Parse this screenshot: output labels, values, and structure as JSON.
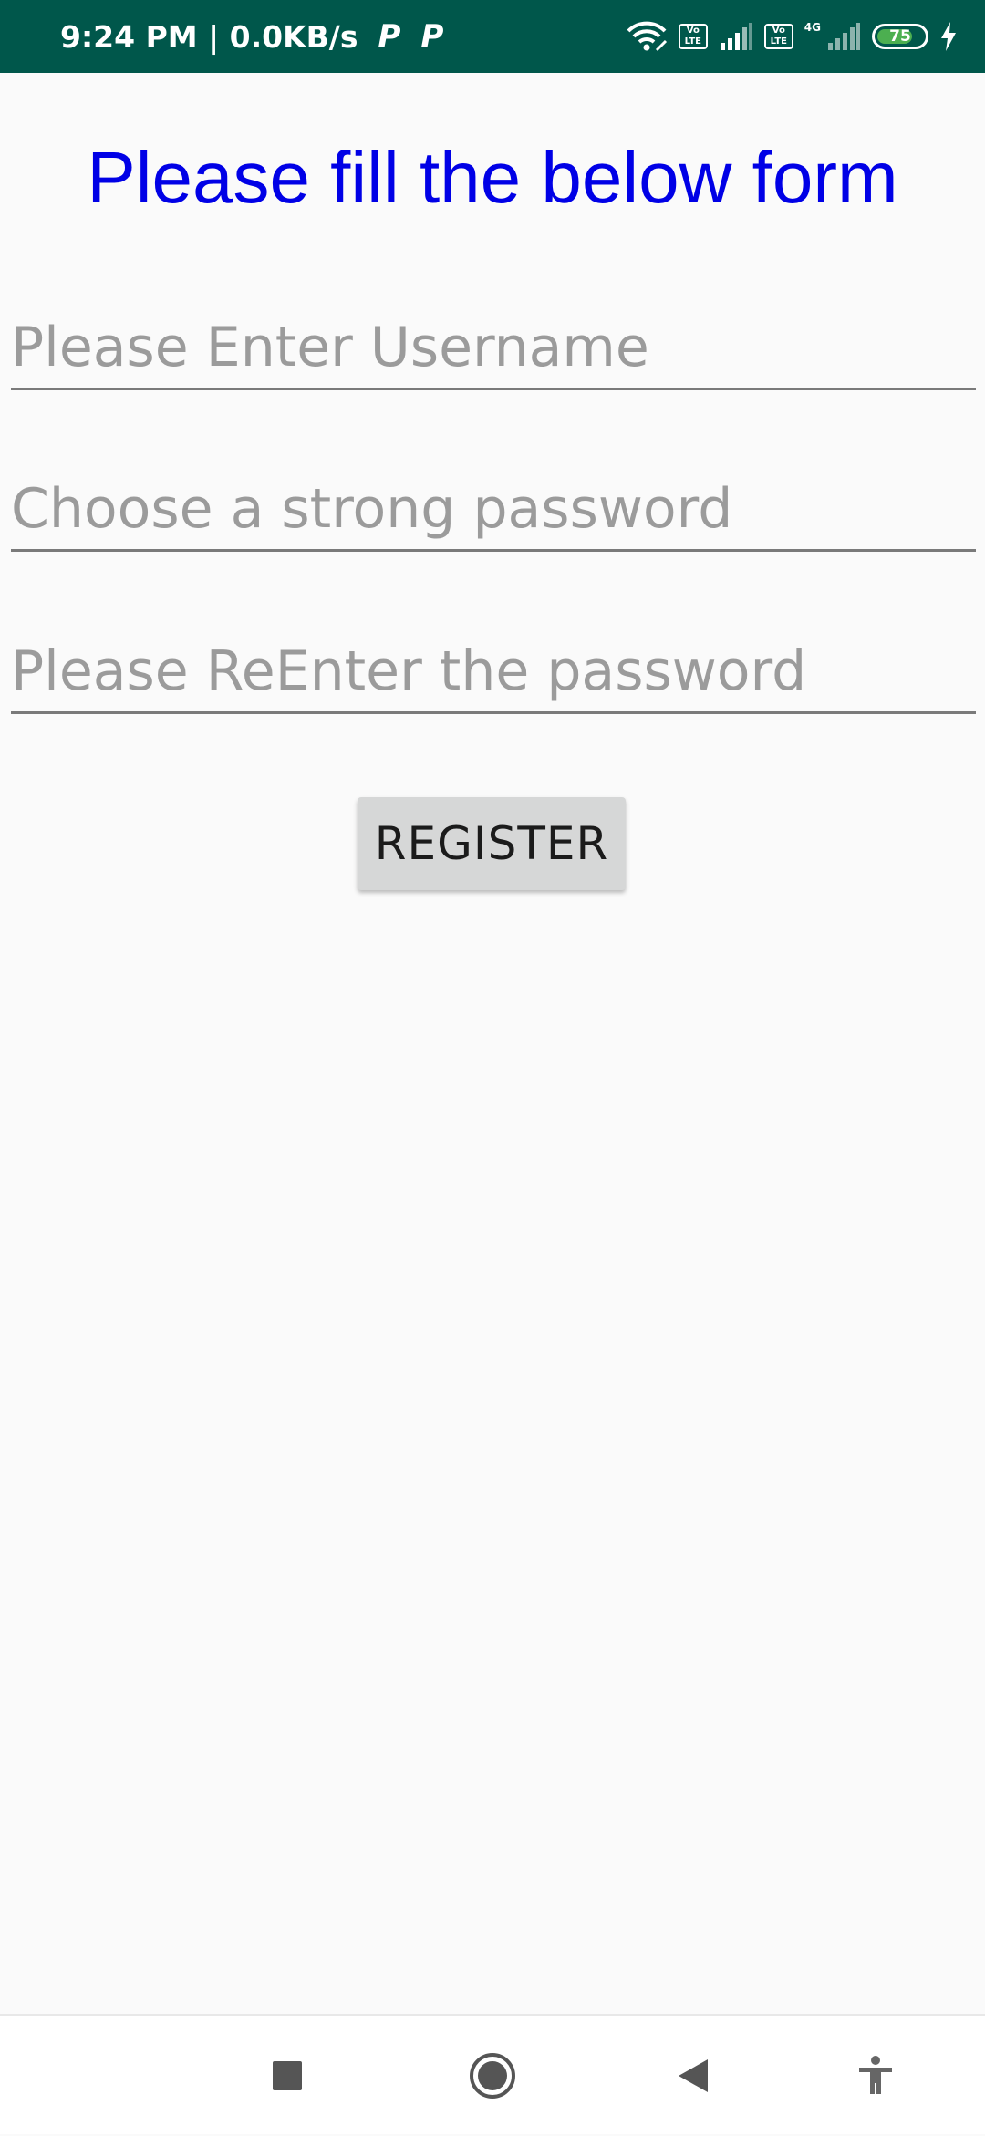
{
  "status_bar": {
    "time_speed": "9:24 PM | 0.0KB/s",
    "app_icon_1": "P",
    "app_icon_2": "P",
    "volte_1": "Vo LTE",
    "volte_2": "Vo LTE",
    "network_type": "4G",
    "battery_level": "75",
    "battery_fraction": 0.75,
    "icons": [
      "wifi-icon",
      "volte-icon",
      "signal-icon",
      "volte-icon",
      "signal-icon",
      "battery-icon",
      "charging-icon"
    ]
  },
  "form": {
    "title": "Please fill the below form",
    "username_placeholder": "Please Enter Username",
    "username_value": "",
    "password_placeholder": "Choose a strong password",
    "password_value": "",
    "confirm_placeholder": "Please ReEnter the password",
    "confirm_value": "",
    "register_label": "REGISTER"
  },
  "nav_bar": {
    "icons": [
      "recents-icon",
      "home-icon",
      "back-icon",
      "accessibility-icon"
    ]
  },
  "colors": {
    "status_bar_bg": "#00574b",
    "title_color": "#0000e6",
    "background": "#fafafa",
    "button_bg": "#d6d7d7",
    "battery_fill": "#4caf50"
  }
}
